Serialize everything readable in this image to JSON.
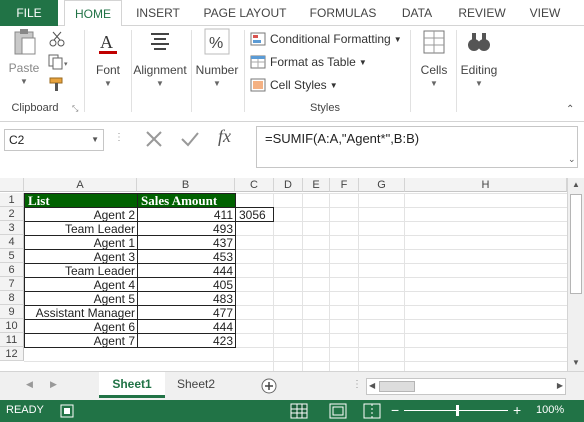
{
  "tabs": [
    {
      "label": "FILE"
    },
    {
      "label": "HOME"
    },
    {
      "label": "INSERT"
    },
    {
      "label": "PAGE LAYOUT"
    },
    {
      "label": "FORMULAS"
    },
    {
      "label": "DATA"
    },
    {
      "label": "REVIEW"
    },
    {
      "label": "VIEW"
    }
  ],
  "ribbon": {
    "paste": "Paste",
    "clipboard": "Clipboard",
    "font": "Font",
    "alignment": "Alignment",
    "number": "Number",
    "conditional_formatting": "Conditional Formatting",
    "format_as_table": "Format as Table",
    "cell_styles": "Cell Styles",
    "styles": "Styles",
    "cells": "Cells",
    "editing": "Editing"
  },
  "formula_bar": {
    "name_box": "C2",
    "formula": "=SUMIF(A:A,\"Agent*\",B:B)"
  },
  "grid": {
    "columns": [
      "A",
      "B",
      "C",
      "D",
      "E",
      "F",
      "G",
      "H"
    ],
    "rows": [
      "1",
      "2",
      "3",
      "4",
      "5",
      "6",
      "7",
      "8",
      "9",
      "10",
      "11",
      "12"
    ],
    "header": {
      "list": "List",
      "sales": "Sales Amount"
    },
    "data": [
      {
        "list": "Agent 2",
        "sales": "411"
      },
      {
        "list": "Team Leader",
        "sales": "493"
      },
      {
        "list": "Agent 1",
        "sales": "437"
      },
      {
        "list": "Agent 3",
        "sales": "453"
      },
      {
        "list": "Team Leader",
        "sales": "444"
      },
      {
        "list": "Agent 4",
        "sales": "405"
      },
      {
        "list": "Agent 5",
        "sales": "483"
      },
      {
        "list": "Assistant Manager",
        "sales": "477"
      },
      {
        "list": "Agent 6",
        "sales": "444"
      },
      {
        "list": "Agent 7",
        "sales": "423"
      }
    ],
    "c2_value": "3056"
  },
  "sheets": [
    {
      "label": "Sheet1"
    },
    {
      "label": "Sheet2"
    }
  ],
  "status": {
    "ready": "READY",
    "zoom": "100%"
  },
  "colors": {
    "accent": "#217346",
    "header_fill": "#006100"
  }
}
